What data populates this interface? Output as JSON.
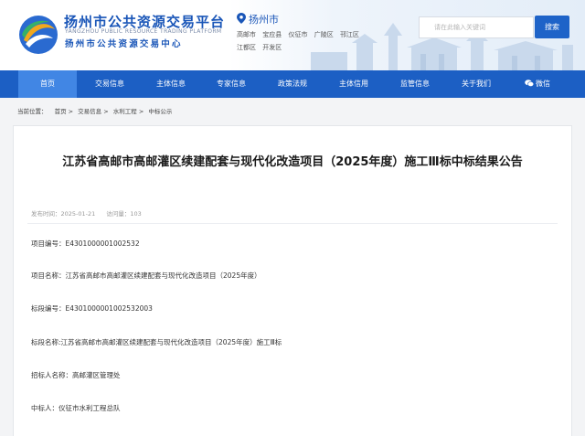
{
  "site": {
    "name": "扬州市公共资源交易平台",
    "name_en": "YANGZHOU PUBLIC RESOURCE TRADING PLATFORM",
    "subtitle": "扬州市公共资源交易中心",
    "city": "扬州市",
    "districts": [
      "高邮市",
      "宝应县",
      "仪征市",
      "广陵区",
      "邗江区",
      "江都区",
      "开发区"
    ]
  },
  "search": {
    "placeholder": "请在此输入关键词",
    "button_label": "搜索"
  },
  "nav": {
    "items": [
      "首页",
      "交易信息",
      "主体信息",
      "专家信息",
      "政策法规",
      "主体信用",
      "监管信息",
      "关于我们",
      "微信"
    ],
    "active": "首页"
  },
  "breadcrumb": {
    "label": "当前位置：",
    "items": [
      "首页 >",
      "交易信息 >",
      "水利工程 >",
      "中标公示"
    ]
  },
  "article": {
    "title": "江苏省高邮市高邮灌区续建配套与现代化改造项目（2025年度）施工Ⅲ标中标结果公告",
    "publish_date": "发布时间：2025-01-21",
    "views": "访问量：103",
    "fields": [
      "项目编号：E4301000001002532",
      "项目名称：江苏省高邮市高邮灌区续建配套与现代化改造项目（2025年度）",
      "标段编号：E4301000001002532003",
      "标段名称:江苏省高邮市高邮灌区续建配套与现代化改造项目（2025年度）施工Ⅲ标",
      "招标人名称：高邮灌区管理处",
      "中标人：仪征市水利工程总队"
    ]
  },
  "colors": {
    "brand": "#1a56b8",
    "nav_bg": "#1c5fc4",
    "nav_active": "#4186e4",
    "search_btn": "#1e63c8"
  },
  "icons": {
    "logo": "site-logo",
    "location": "location-pin-icon",
    "wechat": "wechat-icon"
  }
}
